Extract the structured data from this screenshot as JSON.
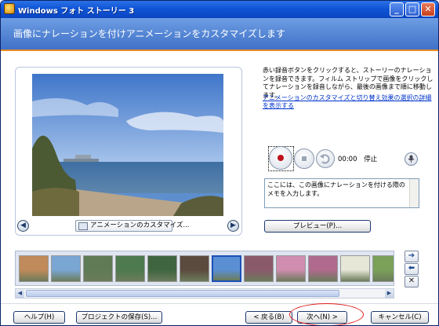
{
  "window": {
    "title": "Windows フォト ストーリー 3",
    "minimize_glyph": "_",
    "maximize_glyph": "□",
    "close_glyph": "✕"
  },
  "header": {
    "title": "画像にナレーションを付けアニメーションをカスタマイズします"
  },
  "instructions": {
    "text": "赤い録音ボタンをクリックすると、ストーリーのナレーションを録音できます。フィルム ストリップで画像をクリックしてナレーションを録音しながら、最後の画像まで順に移動します。",
    "link": "アニメーションのカスタマイズと切り替え効果の選択の詳細を表示する"
  },
  "preview": {
    "customize_label": "アニメーションのカスタマイズ...",
    "prev_glyph": "◀",
    "next_glyph": "▶"
  },
  "recording": {
    "time": "00:00",
    "status": "停止",
    "narration_placeholder": "ここには、この画像にナレーションを付ける際のメモを入力します。",
    "preview_button": "プレビュー(P)..."
  },
  "filmstrip": {
    "selected_index": 6,
    "thumb_count": 12,
    "colors": [
      "#c08a5a",
      "#7aa6d4",
      "#5f7b55",
      "#4d7a4f",
      "#3e6440",
      "#5b4a3e",
      "#5b8fd3",
      "#8a5a6b",
      "#d08db0",
      "#b06a8e",
      "#e7e7d8",
      "#7aa05a"
    ],
    "move_right_glyph": "➔",
    "move_left_glyph": "⬅",
    "remove_glyph": "✕",
    "scroll_left_glyph": "◀",
    "scroll_right_glyph": "▶"
  },
  "footer": {
    "help": "ヘルプ(H)",
    "save_project": "プロジェクトの保存(S)...",
    "back": "< 戻る(B)",
    "next": "次へ(N) >",
    "cancel": "キャンセル(C)"
  }
}
